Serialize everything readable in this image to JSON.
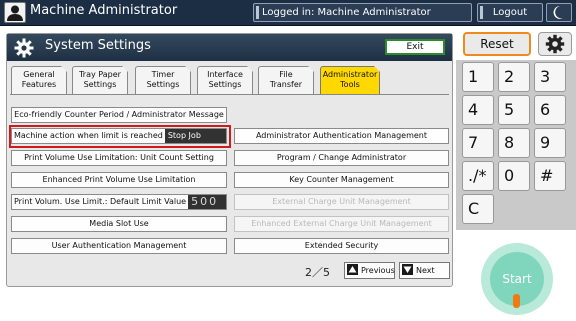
{
  "topbar": {
    "title": "Machine Administrator",
    "login_status": "Logged in: Machine Administrator",
    "logout_label": "Logout",
    "user_icon": "user-icon",
    "moon_icon": "moon-icon"
  },
  "panel": {
    "title": "System Settings",
    "exit_label": "Exit",
    "gear_icon": "gear-icon"
  },
  "tabs": [
    {
      "label": "General\nFeatures"
    },
    {
      "label": "Tray Paper\nSettings"
    },
    {
      "label": "Timer\nSettings"
    },
    {
      "label": "Interface\nSettings"
    },
    {
      "label": "File\nTransfer"
    },
    {
      "label": "Administrator\nTools"
    }
  ],
  "left_items": {
    "eco": "Eco-friendly Counter Period / Administrator Message",
    "limit_label": "Machine action when limit is reached",
    "limit_value": "Stop Job",
    "print_volume_unit": "Print Volume Use Limitation: Unit Count Setting",
    "enhanced_print_volume": "Enhanced Print Volume Use Limitation",
    "default_limit_label": "Print Volum. Use Limit.: Default Limit Value",
    "default_limit_value": "500",
    "media_slot": "Media Slot Use",
    "user_auth": "User Authentication Management"
  },
  "right_items": {
    "admin_auth": "Administrator Authentication Management",
    "program_admin": "Program / Change Administrator",
    "key_counter": "Key Counter Management",
    "external_charge": "External Charge Unit Management",
    "enhanced_external_charge": "Enhanced External Charge Unit Management",
    "extended_security": "Extended Security"
  },
  "pager": {
    "page": "2／5",
    "previous_label": "Previous",
    "next_label": "Next"
  },
  "right_panel": {
    "reset_label": "Reset",
    "keys": [
      "1",
      "2",
      "3",
      "4",
      "5",
      "6",
      "7",
      "8",
      "9",
      "./*",
      "0",
      "#",
      "C"
    ],
    "start_label": "Start"
  },
  "colors": {
    "header_bg": "#1c2e44",
    "active_tab": "#ffd800",
    "exit_border": "#2d8a2d",
    "reset_border": "#f08a1c",
    "highlight_border": "#d11a1a",
    "start_bg": "#7fd6bd",
    "start_led": "#f07a12"
  }
}
